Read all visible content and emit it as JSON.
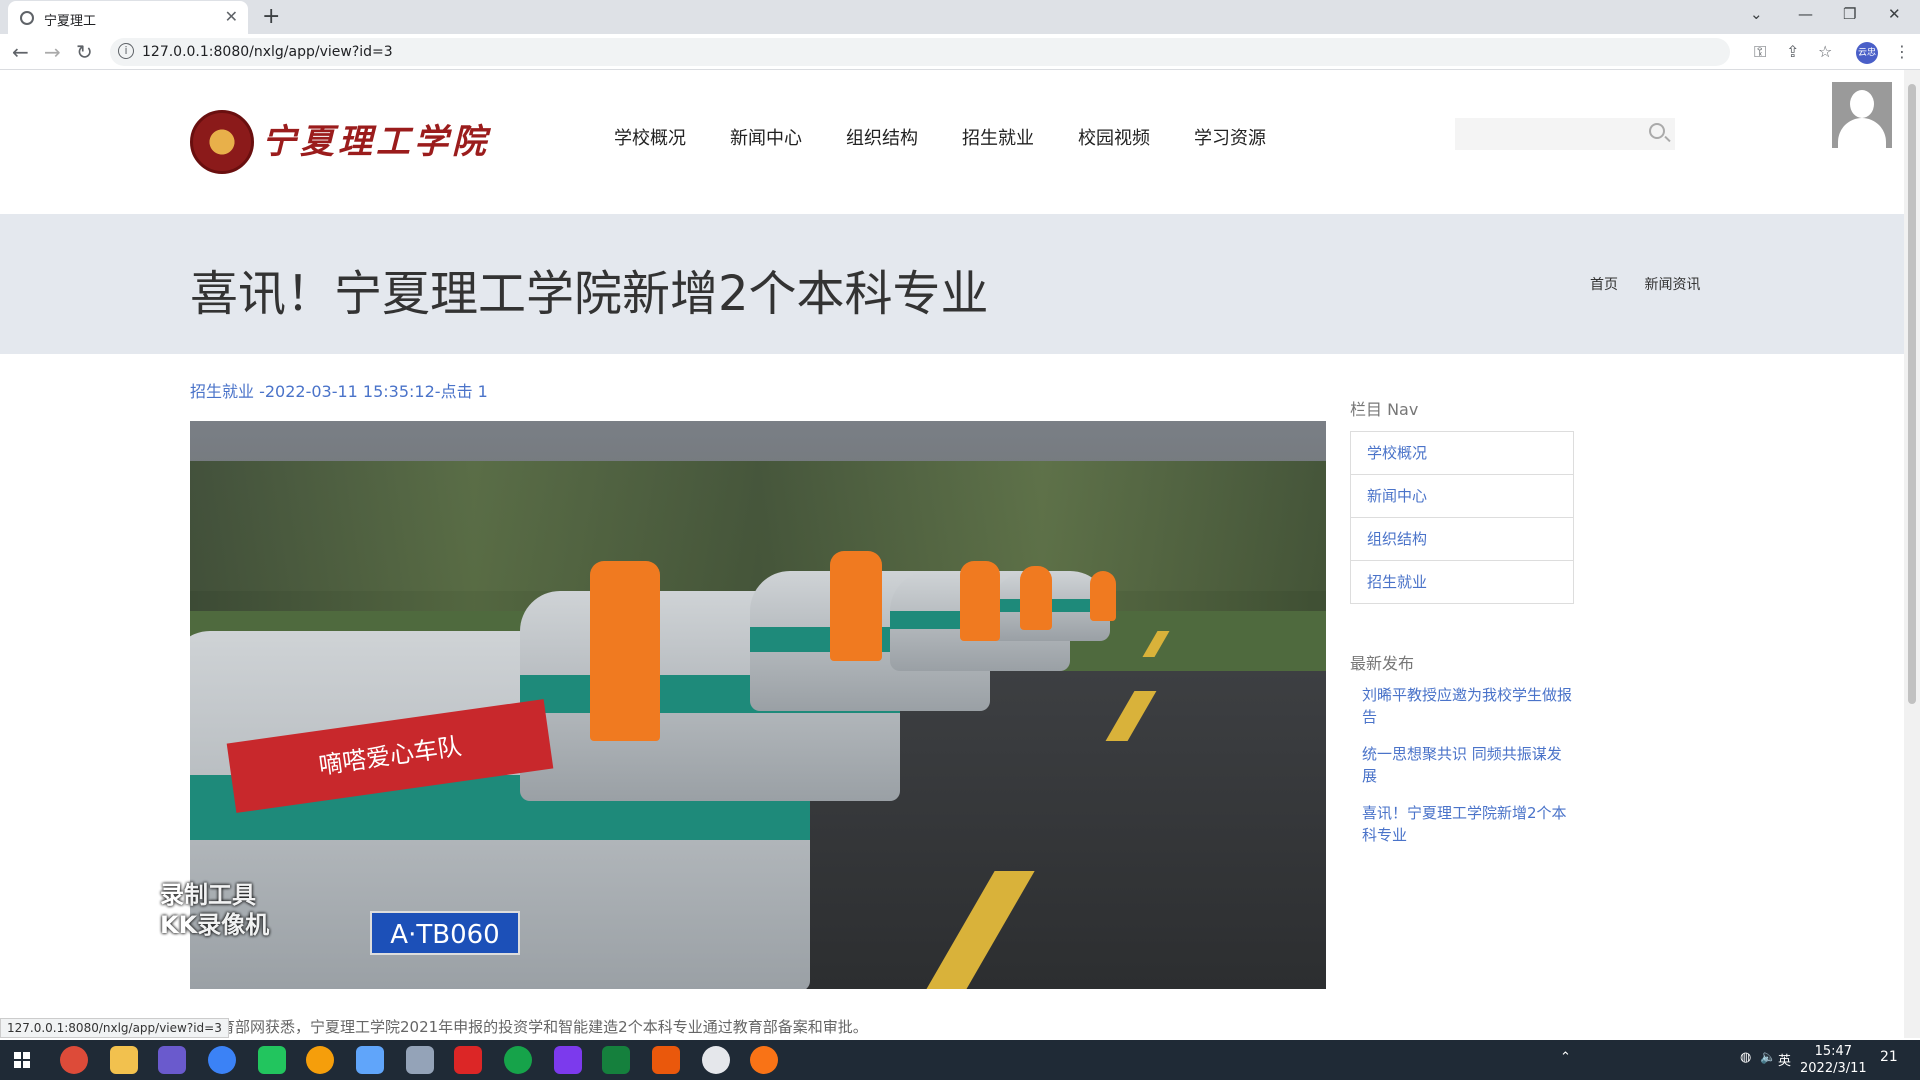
{
  "browser": {
    "tab_title": "宁夏理工",
    "url": "127.0.0.1:8080/nxlg/app/view?id=3",
    "profile_label": "云忠"
  },
  "site": {
    "logo_text": "宁夏理工学院",
    "nav": [
      "学校概况",
      "新闻中心",
      "组织结构",
      "招生就业",
      "校园视频",
      "学习资源"
    ],
    "search_placeholder": ""
  },
  "article": {
    "title": "喜讯！宁夏理工学院新增2个本科专业",
    "breadcrumb": [
      "首页",
      "新闻资讯"
    ],
    "meta": "招生就业 -2022-03-11 15:35:12-点击 1",
    "body_first_line": "从教育部网获悉，宁夏理工学院2021年申报的投资学和智能建造2个本科专业通过教育部备案和审批。",
    "hero_banner": "嘀嗒爱心车队",
    "hero_plate": "A·TB060"
  },
  "watermark": {
    "line1": "录制工具",
    "line2": "KK录像机"
  },
  "sidebar": {
    "nav_heading": "栏目 Nav",
    "nav_items": [
      "学校概况",
      "新闻中心",
      "组织结构",
      "招生就业"
    ],
    "latest_heading": "最新发布",
    "latest_items": [
      "刘晞平教授应邀为我校学生做报告",
      "统一思想聚共识 同频共振谋发展",
      "喜讯！宁夏理工学院新增2个本科专业"
    ]
  },
  "status_url": "127.0.0.1:8080/nxlg/app/view?id=3",
  "taskbar": {
    "time": "15:47",
    "date": "2022/3/11",
    "ime": "英",
    "notifications": "21"
  }
}
